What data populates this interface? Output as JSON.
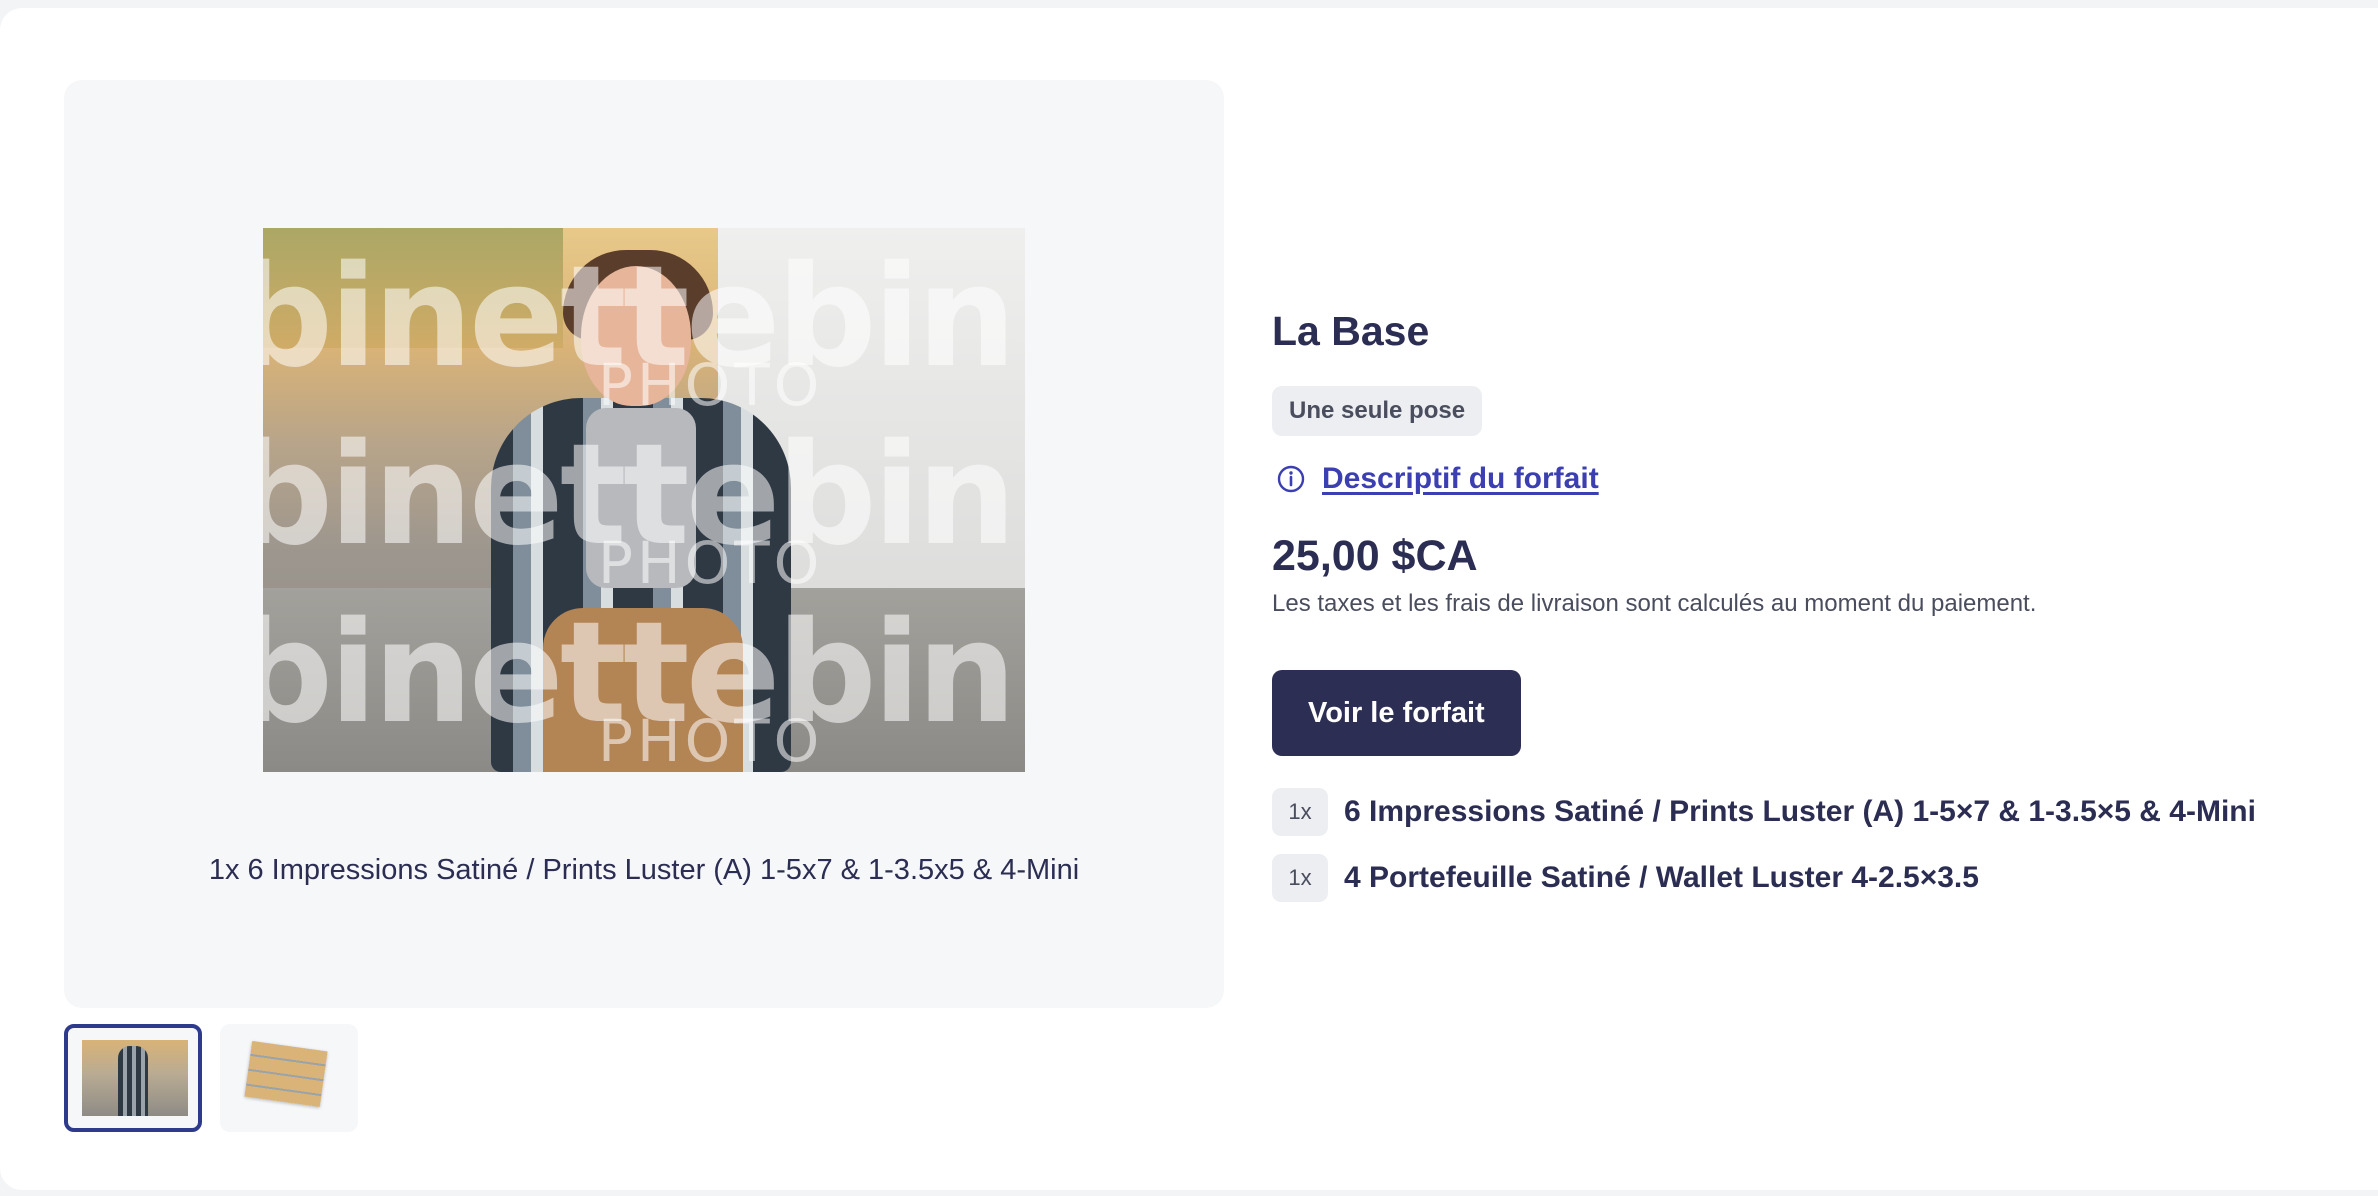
{
  "product": {
    "title": "La Base",
    "badge": "Une seule pose",
    "description_link": "Descriptif du forfait",
    "price": "25,00 $CA",
    "tax_note": "Les taxes et les frais de livraison sont calculés au moment du paiement.",
    "cta_label": "Voir le forfait",
    "items": [
      {
        "qty": "1x",
        "label": "6 Impressions Satiné / Prints Luster (A) 1-5×7 & 1-3.5×5 & 4-Mini"
      },
      {
        "qty": "1x",
        "label": "4 Portefeuille Satiné / Wallet Luster 4-2.5×3.5"
      }
    ]
  },
  "gallery": {
    "caption": "1x 6 Impressions Satiné / Prints Luster (A) 1-5x7 & 1-3.5x5 & 4-Mini",
    "watermark": "binettebin",
    "watermark_sub": "PHOTO"
  },
  "colors": {
    "primary": "#2c2e54",
    "link": "#3b3fb1",
    "badge_bg": "#eceef1",
    "gallery_bg": "#f6f7f9",
    "active_thumb_border": "#2e3a8c"
  },
  "icons": {
    "info": "info-circle-icon"
  }
}
